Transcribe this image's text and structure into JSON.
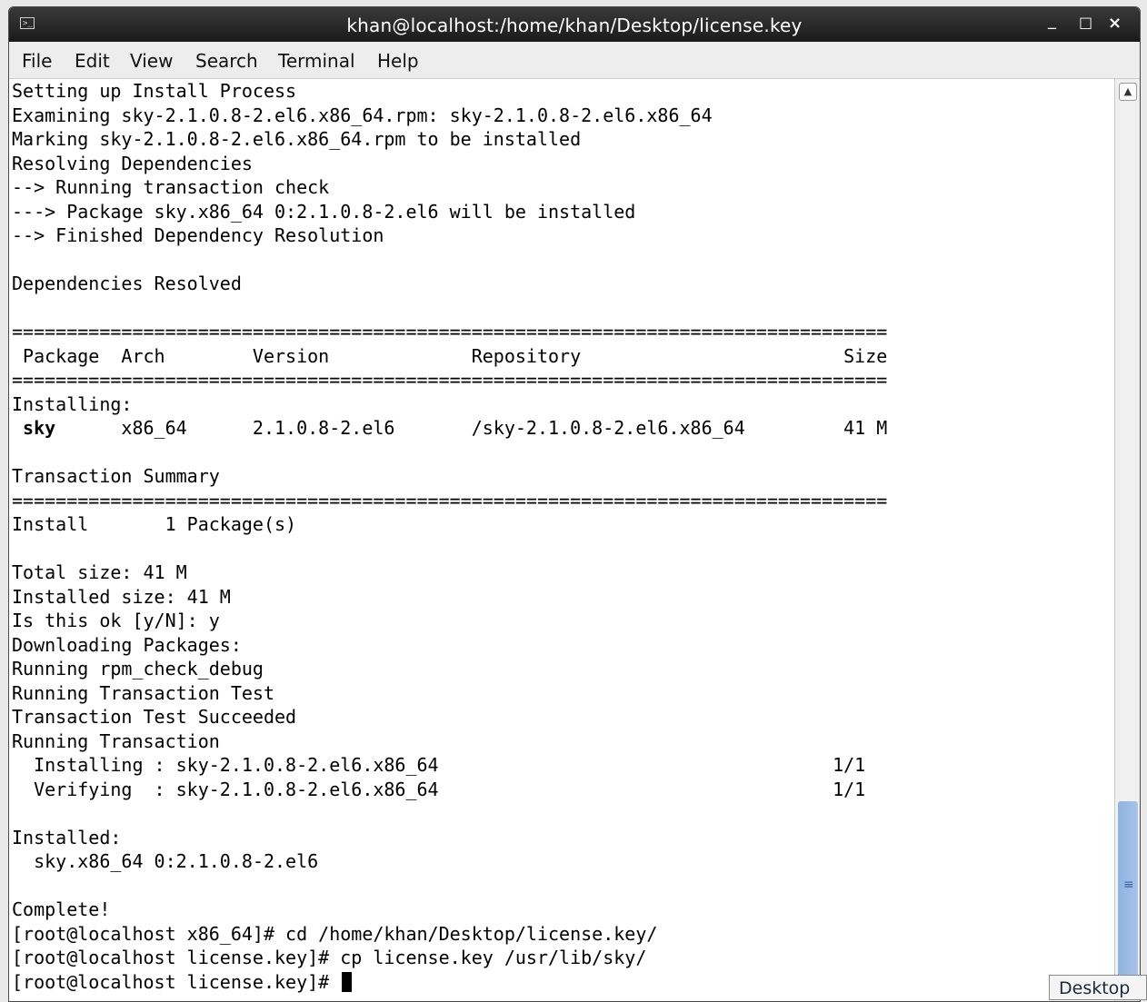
{
  "window": {
    "title": "khan@localhost:/home/khan/Desktop/license.key",
    "icon": "terminal-icon",
    "controls": {
      "minimize": "_",
      "maximize": "□",
      "close": "×"
    }
  },
  "menubar": [
    "File",
    "Edit",
    "View",
    "Search",
    "Terminal",
    "Help"
  ],
  "terminal": {
    "lines": [
      "Setting up Install Process",
      "Examining sky-2.1.0.8-2.el6.x86_64.rpm: sky-2.1.0.8-2.el6.x86_64",
      "Marking sky-2.1.0.8-2.el6.x86_64.rpm to be installed",
      "Resolving Dependencies",
      "--> Running transaction check",
      "---> Package sky.x86_64 0:2.1.0.8-2.el6 will be installed",
      "--> Finished Dependency Resolution",
      "",
      "Dependencies Resolved",
      "",
      "================================================================================",
      " Package  Arch        Version             Repository                        Size",
      "================================================================================",
      "Installing:",
      " sky      x86_64      2.1.0.8-2.el6       /sky-2.1.0.8-2.el6.x86_64         41 M",
      "",
      "Transaction Summary",
      "================================================================================",
      "Install       1 Package(s)",
      "",
      "Total size: 41 M",
      "Installed size: 41 M",
      "Is this ok [y/N]: y",
      "Downloading Packages:",
      "Running rpm_check_debug",
      "Running Transaction Test",
      "Transaction Test Succeeded",
      "Running Transaction",
      "  Installing : sky-2.1.0.8-2.el6.x86_64                                    1/1",
      "  Verifying  : sky-2.1.0.8-2.el6.x86_64                                    1/1",
      "",
      "Installed:",
      "  sky.x86_64 0:2.1.0.8-2.el6",
      "",
      "Complete!",
      "[root@localhost x86_64]# cd /home/khan/Desktop/license.key/",
      "[root@localhost license.key]# cp license.key /usr/lib/sky/",
      "[root@localhost license.key]# "
    ]
  },
  "taskbar": {
    "desktop_label": "Desktop"
  },
  "colors": {
    "titlebar": "#1f1f1f",
    "scroll_thumb": "#9bbbe6",
    "terminal_bg": "#ffffff"
  }
}
